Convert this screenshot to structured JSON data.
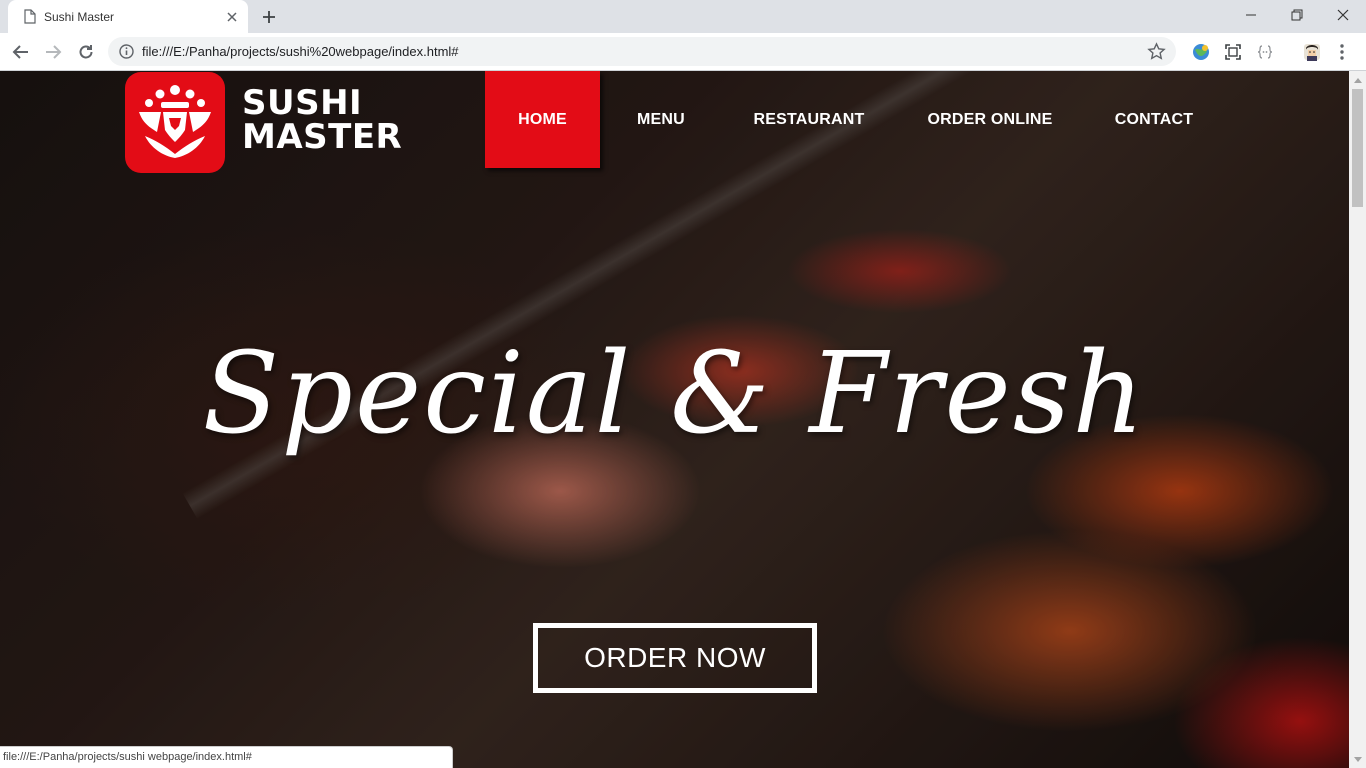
{
  "browser": {
    "tab_title": "Sushi Master",
    "url": "file:///E:/Panha/projects/sushi%20webpage/index.html#",
    "status_url": "file:///E:/Panha/projects/sushi webpage/index.html#"
  },
  "site": {
    "logo_line1": "SUSHI",
    "logo_line2": "MASTER",
    "brand_color": "#e30c16",
    "nav": [
      {
        "label": "HOME",
        "active": true
      },
      {
        "label": "MENU",
        "active": false
      },
      {
        "label": "RESTAURANT",
        "active": false
      },
      {
        "label": "ORDER ONLINE",
        "active": false
      },
      {
        "label": "CONTACT",
        "active": false
      }
    ],
    "headline": "Special & Fresh",
    "cta_label": "ORDER NOW"
  }
}
